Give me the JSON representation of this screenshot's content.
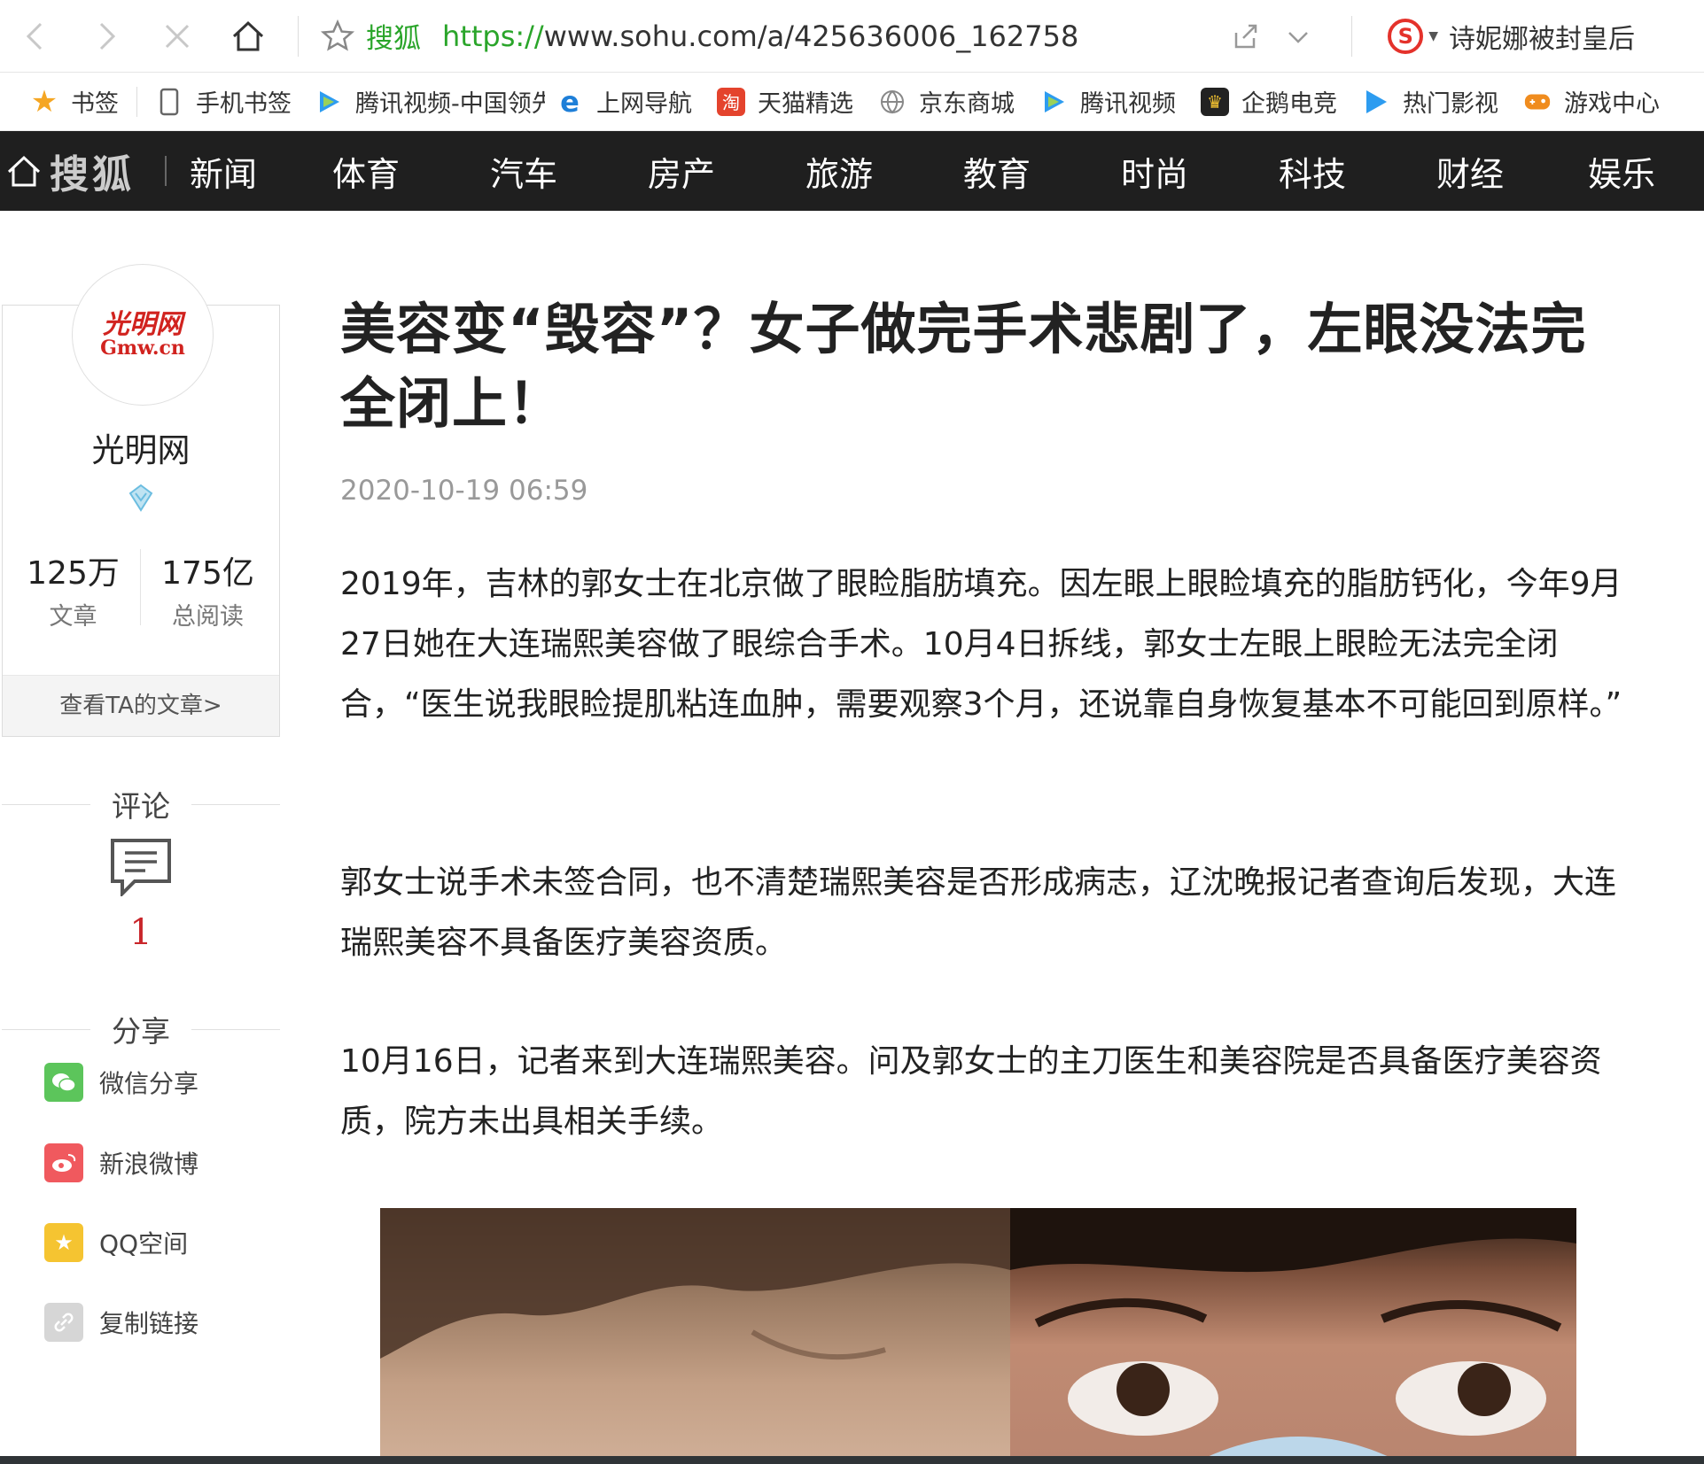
{
  "browser": {
    "site_name": "搜狐",
    "url_scheme": "https://",
    "url_rest": "www.sohu.com/a/425636006_162758",
    "hot_search": "诗妮娜被封皇后"
  },
  "bookmarks": [
    {
      "label": "书签",
      "icon": "star-icon",
      "color": "#f5a623"
    },
    {
      "label": "手机书签",
      "icon": "phone-icon",
      "color": "#666666"
    },
    {
      "label": "腾讯视频-中国领先",
      "icon": "tencent-video-icon",
      "color": "#2d9cf0"
    },
    {
      "label": "上网导航",
      "icon": "ie-icon",
      "color": "#1e7fd8"
    },
    {
      "label": "天猫精选",
      "icon": "tmall-icon",
      "color": "#e4432d"
    },
    {
      "label": "京东商城",
      "icon": "globe-icon",
      "color": "#888888"
    },
    {
      "label": "腾讯视频",
      "icon": "tencent-video-icon",
      "color": "#2d9cf0"
    },
    {
      "label": "企鹅电竞",
      "icon": "penguin-icon",
      "color": "#222222"
    },
    {
      "label": "热门影视",
      "icon": "play-icon",
      "color": "#2d9cf0"
    },
    {
      "label": "游戏中心",
      "icon": "gamepad-icon",
      "color": "#f08c1e"
    }
  ],
  "sohu_nav": {
    "logo": "搜狐",
    "items": [
      "新闻",
      "体育",
      "汽车",
      "房产",
      "旅游",
      "教育",
      "时尚",
      "科技",
      "财经",
      "娱乐"
    ]
  },
  "author": {
    "avatar_text": "光明网",
    "avatar_sub": "Gmw.cn",
    "name": "光明网",
    "articles_num": "125万",
    "articles_label": "文章",
    "reads_num": "175亿",
    "reads_label": "总阅读",
    "more_link": "查看TA的文章>"
  },
  "comments": {
    "title": "评论",
    "count": "1"
  },
  "share": {
    "title": "分享",
    "items": [
      {
        "label": "微信分享",
        "color": "#5cc55b"
      },
      {
        "label": "新浪微博",
        "color": "#f0595e"
      },
      {
        "label": "QQ空间",
        "color": "#f5c431"
      },
      {
        "label": "复制链接",
        "color": "#d6d6d6"
      }
    ]
  },
  "article": {
    "title": "美容变“毁容”？女子做完手术悲剧了，左眼没法完全闭上！",
    "time": "2020-10-19 06:59",
    "paragraphs": [
      "2019年，吉林的郭女士在北京做了眼睑脂肪填充。因左眼上眼睑填充的脂肪钙化，今年9月27日她在大连瑞熙美容做了眼综合手术。10月4日拆线，郭女士左眼上眼睑无法完全闭合，“医生说我眼睑提肌粘连血肿，需要观察3个月，还说靠自身恢复基本不可能回到原样。”",
      "郭女士说手术未签合同，也不清楚瑞熙美容是否形成病志，辽沈晚报记者查询后发现，大连瑞熙美容不具备医疗美容资质。",
      "10月16日，记者来到大连瑞熙美容。问及郭女士的主刀医生和美容院是否具备医疗美容资质，院方未出具相关手续。"
    ]
  }
}
